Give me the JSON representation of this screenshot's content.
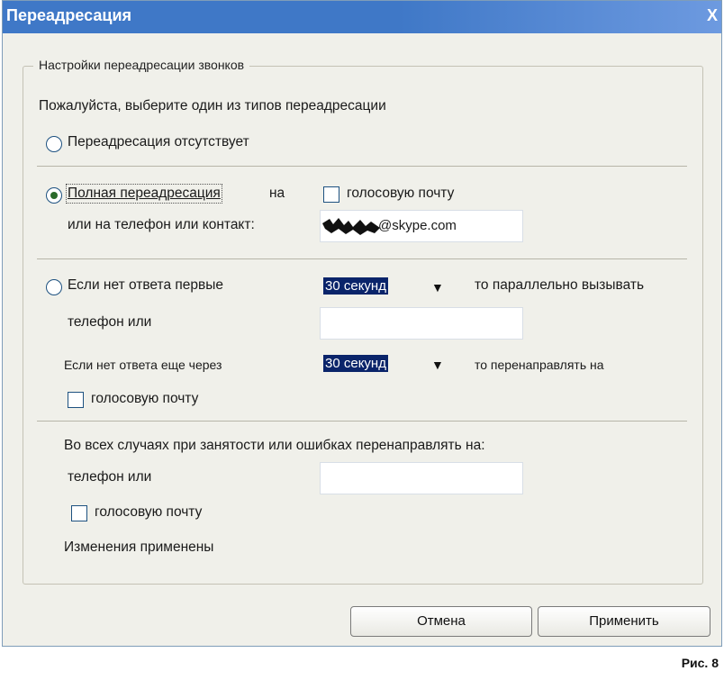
{
  "window": {
    "title": "Переадресация",
    "close_label": "X"
  },
  "group": {
    "legend": "Настройки переадресации звонков"
  },
  "prompt": "Пожалуйста, выберите один из типов переадресации",
  "option_none": {
    "label": "Переадресация отсутствует",
    "selected": false
  },
  "option_full": {
    "label": "Полная переадресация",
    "label_suffix": "на",
    "selected": true,
    "voicemail_label": "голосовую почту",
    "voicemail_checked": false,
    "target_label": "или на телефон или контакт:",
    "target_value": "@skype.com"
  },
  "option_noanswer": {
    "label": "Если нет ответа первые",
    "selected": false,
    "delay1": "30 секунд",
    "parallel_label": "то параллельно вызывать",
    "phone_label": "телефон или",
    "phone_value": "",
    "again_label": "Если нет ответа еще через",
    "delay2": "30 секунд",
    "redirect_label": "то перенаправлять на",
    "voicemail_label": "голосовую почту",
    "voicemail_checked": false
  },
  "busy": {
    "label": "Во всех случаях при занятости или ошибках перенаправлять на:",
    "phone_label": "телефон или",
    "phone_value": "",
    "voicemail_label": "голосовую почту",
    "voicemail_checked": false
  },
  "status": "Изменения применены",
  "buttons": {
    "cancel": "Отмена",
    "apply": "Применить"
  },
  "caption": "Рис. 8",
  "icons": {
    "dropdown": "▼"
  },
  "colors": {
    "titlebar": "#3f78c7",
    "selection": "#0a246a",
    "dialog_bg": "#f0f0ea"
  }
}
